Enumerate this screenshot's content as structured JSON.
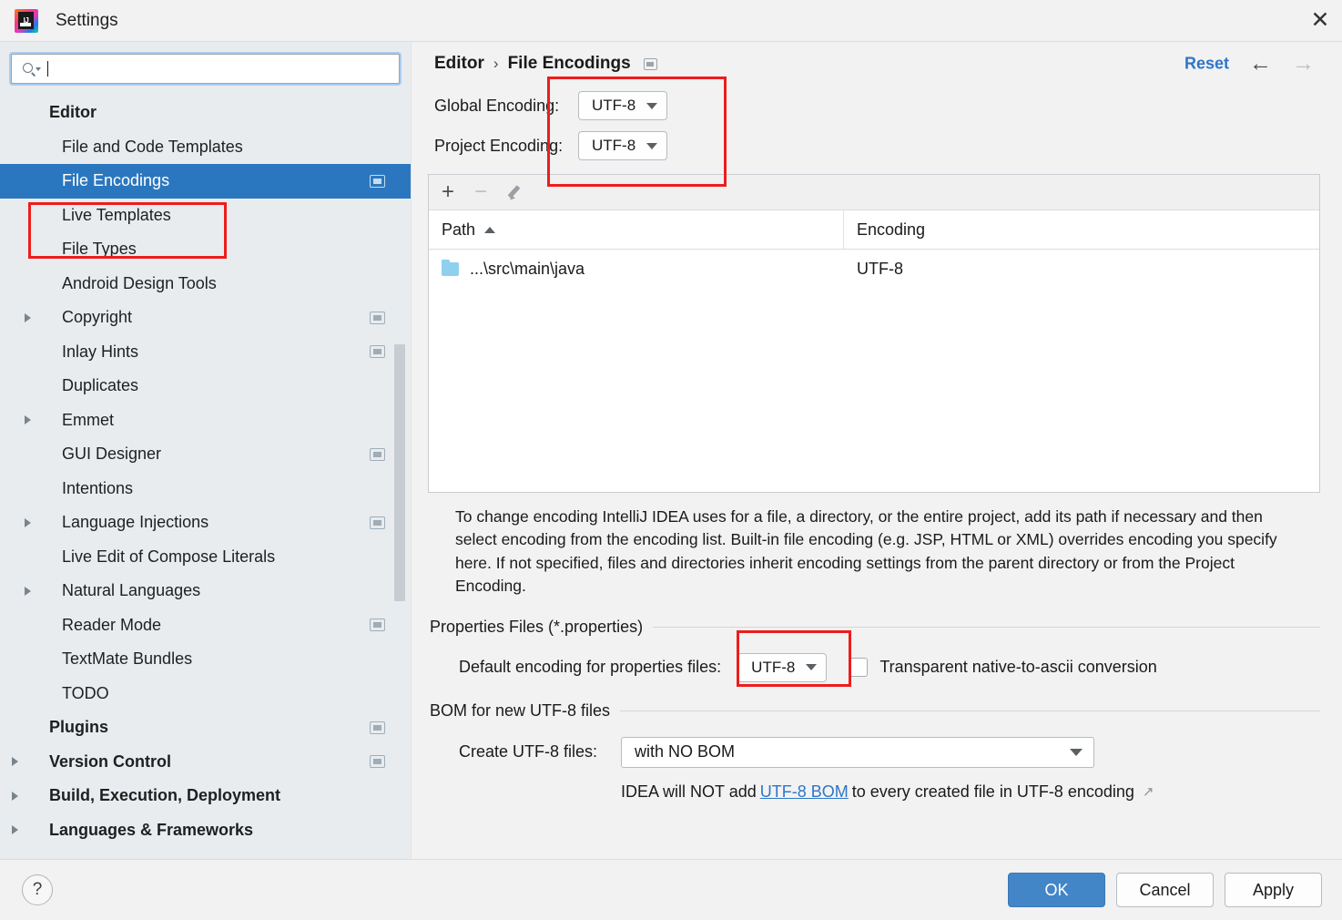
{
  "window": {
    "title": "Settings",
    "logo_icon": "intellij-idea-logo",
    "close_icon": "close-icon"
  },
  "search": {
    "value": "",
    "placeholder": "",
    "icon": "search-icon"
  },
  "sidebar": {
    "items": [
      {
        "label": "Editor",
        "bold": true,
        "chevron": false,
        "badge": false,
        "selected": false,
        "indent": 0
      },
      {
        "label": "File and Code Templates",
        "bold": false,
        "chevron": false,
        "badge": false,
        "selected": false,
        "indent": 1
      },
      {
        "label": "File Encodings",
        "bold": false,
        "chevron": false,
        "badge": true,
        "selected": true,
        "indent": 1
      },
      {
        "label": "Live Templates",
        "bold": false,
        "chevron": false,
        "badge": false,
        "selected": false,
        "indent": 1
      },
      {
        "label": "File Types",
        "bold": false,
        "chevron": false,
        "badge": false,
        "selected": false,
        "indent": 1
      },
      {
        "label": "Android Design Tools",
        "bold": false,
        "chevron": false,
        "badge": false,
        "selected": false,
        "indent": 1
      },
      {
        "label": "Copyright",
        "bold": false,
        "chevron": true,
        "badge": true,
        "selected": false,
        "indent": 1
      },
      {
        "label": "Inlay Hints",
        "bold": false,
        "chevron": false,
        "badge": true,
        "selected": false,
        "indent": 1
      },
      {
        "label": "Duplicates",
        "bold": false,
        "chevron": false,
        "badge": false,
        "selected": false,
        "indent": 1
      },
      {
        "label": "Emmet",
        "bold": false,
        "chevron": true,
        "badge": false,
        "selected": false,
        "indent": 1
      },
      {
        "label": "GUI Designer",
        "bold": false,
        "chevron": false,
        "badge": true,
        "selected": false,
        "indent": 1
      },
      {
        "label": "Intentions",
        "bold": false,
        "chevron": false,
        "badge": false,
        "selected": false,
        "indent": 1
      },
      {
        "label": "Language Injections",
        "bold": false,
        "chevron": true,
        "badge": true,
        "selected": false,
        "indent": 1
      },
      {
        "label": "Live Edit of Compose Literals",
        "bold": false,
        "chevron": false,
        "badge": false,
        "selected": false,
        "indent": 1
      },
      {
        "label": "Natural Languages",
        "bold": false,
        "chevron": true,
        "badge": false,
        "selected": false,
        "indent": 1
      },
      {
        "label": "Reader Mode",
        "bold": false,
        "chevron": false,
        "badge": true,
        "selected": false,
        "indent": 1
      },
      {
        "label": "TextMate Bundles",
        "bold": false,
        "chevron": false,
        "badge": false,
        "selected": false,
        "indent": 1
      },
      {
        "label": "TODO",
        "bold": false,
        "chevron": false,
        "badge": false,
        "selected": false,
        "indent": 1
      },
      {
        "label": "Plugins",
        "bold": true,
        "chevron": false,
        "badge": true,
        "selected": false,
        "indent": 0
      },
      {
        "label": "Version Control",
        "bold": true,
        "chevron": true,
        "badge": true,
        "selected": false,
        "indent": 0
      },
      {
        "label": "Build, Execution, Deployment",
        "bold": true,
        "chevron": true,
        "badge": false,
        "selected": false,
        "indent": 0
      },
      {
        "label": "Languages & Frameworks",
        "bold": true,
        "chevron": true,
        "badge": false,
        "selected": false,
        "indent": 0
      }
    ]
  },
  "header": {
    "breadcrumb_root": "Editor",
    "breadcrumb_separator": "›",
    "breadcrumb_current": "File Encodings",
    "breadcrumb_badge_icon": "project-scope-badge-icon",
    "reset_label": "Reset",
    "back_arrow_icon": "arrow-left-icon",
    "forward_arrow_icon": "arrow-right-icon",
    "back_arrow": "←",
    "forward_arrow": "→"
  },
  "encodings": {
    "global_label": "Global Encoding:",
    "global_value": "UTF-8",
    "project_label": "Project Encoding:",
    "project_value": "UTF-8"
  },
  "table": {
    "toolbar": {
      "add_icon": "plus-icon",
      "add_glyph": "+",
      "remove_icon": "minus-icon",
      "remove_glyph": "−",
      "edit_icon": "pencil-icon"
    },
    "columns": [
      "Path",
      "Encoding"
    ],
    "sort_column": "Path",
    "sort_direction": "asc",
    "rows": [
      {
        "path": "...\\src\\main\\java",
        "encoding": "UTF-8",
        "icon": "folder-icon"
      }
    ]
  },
  "description": "To change encoding IntelliJ IDEA uses for a file, a directory, or the entire project, add its path if necessary and then select encoding from the encoding list. Built-in file encoding (e.g. JSP, HTML or XML) overrides encoding you specify here. If not specified, files and directories inherit encoding settings from the parent directory or from the Project Encoding.",
  "properties_section": {
    "title": "Properties Files (*.properties)",
    "default_encoding_label": "Default encoding for properties files:",
    "default_encoding_value": "UTF-8",
    "transparent_label": "Transparent native-to-ascii conversion",
    "transparent_checked": false
  },
  "bom_section": {
    "title": "BOM for new UTF-8 files",
    "create_label": "Create UTF-8 files:",
    "create_value": "with NO BOM",
    "note_prefix": "IDEA will NOT add",
    "note_link": "UTF-8 BOM",
    "note_suffix": "to every created file in UTF-8 encoding",
    "external_link_icon": "external-link-icon",
    "external_link_glyph": "↗"
  },
  "footer": {
    "help_icon": "help-icon",
    "help_glyph": "?",
    "ok_label": "OK",
    "cancel_label": "Cancel",
    "apply_label": "Apply"
  },
  "annotations": {
    "highlight_color": "#ee1c1c",
    "boxes": [
      "sidebar-file-encodings",
      "encoding-dropdowns",
      "properties-default-encoding"
    ]
  },
  "colors": {
    "selection_blue": "#2B77BF",
    "link_blue": "#2E76C8",
    "primary_button": "#4286c7",
    "sidebar_bg": "#e8ecef",
    "panel_bg": "#f2f2f2"
  }
}
